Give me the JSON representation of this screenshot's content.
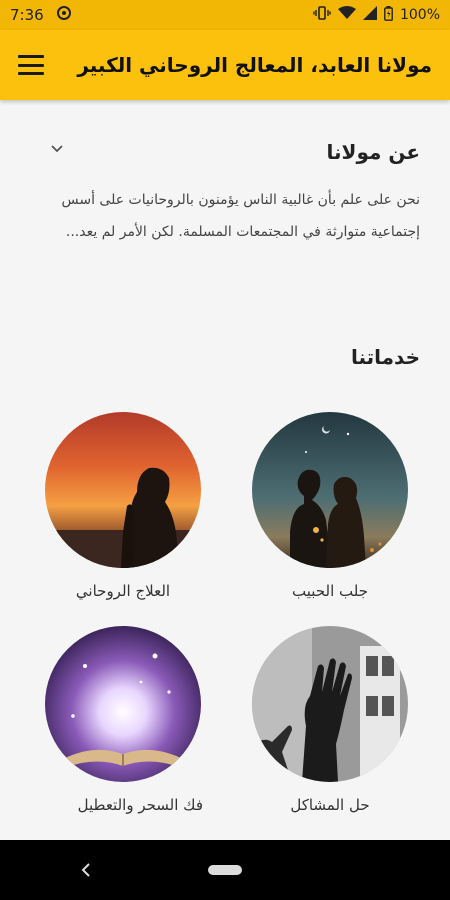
{
  "status_bar": {
    "time": "7:36",
    "battery": "100%",
    "icons": [
      "data-saver-icon",
      "vibrate-icon",
      "wifi-icon",
      "cell-signal-icon",
      "battery-icon"
    ]
  },
  "app_bar": {
    "title": "مولانا العابد، المعالج الروحاني الكبير",
    "menu_icon": "hamburger-menu-icon"
  },
  "about": {
    "title": "عن مولانا",
    "toggle_icon": "chevron-down-icon",
    "text": "نحن على علم بأن غالبية الناس يؤمنون بالروحانيات على أسس إجتماعية متوارثة في المجتمعات المسلمة. لكن الأمر لم يعد..."
  },
  "services": {
    "title": "خدماتنا",
    "items": [
      {
        "label": "جلب الحبيب"
      },
      {
        "label": "العلاج الروحاني"
      },
      {
        "label": "حل المشاكل"
      },
      {
        "label": "فك السحر والتعطيل"
      }
    ]
  },
  "fab": {
    "icon": "whatsapp-icon",
    "color": "#25c45d"
  },
  "nav_bar": {
    "icons": [
      "back-icon",
      "home-pill-icon"
    ]
  },
  "colors": {
    "accent": "#fcc10c",
    "status": "#f2b705"
  }
}
